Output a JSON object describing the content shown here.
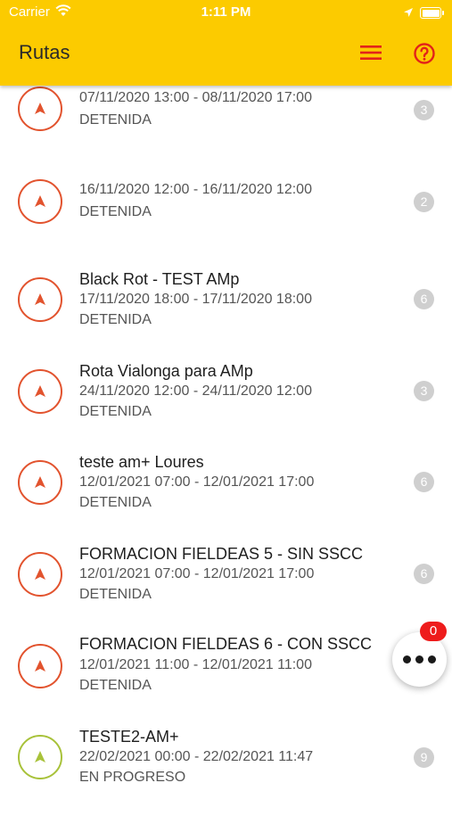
{
  "status_bar": {
    "carrier": "Carrier",
    "time": "1:11 PM"
  },
  "header": {
    "title": "Rutas",
    "menu_icon": "hamburger-menu-icon",
    "help_icon": "question-circle-icon",
    "background_color": "#fccb00",
    "icon_color": "#e2231a"
  },
  "routes": [
    {
      "title": "",
      "dates": "07/11/2020 13:00 - 08/11/2020 17:00",
      "status": "DETENIDA",
      "count": "3",
      "icon": "navigation-arrow-icon",
      "color": "#e2532e"
    },
    {
      "title": "",
      "dates": "16/11/2020 12:00 - 16/11/2020 12:00",
      "status": "DETENIDA",
      "count": "2",
      "icon": "navigation-arrow-icon",
      "color": "#e2532e"
    },
    {
      "title": "Black Rot - TEST AMp",
      "dates": "17/11/2020 18:00 - 17/11/2020 18:00",
      "status": "DETENIDA",
      "count": "6",
      "icon": "navigation-arrow-icon",
      "color": "#e2532e"
    },
    {
      "title": "Rota Vialonga para AMp",
      "dates": "24/11/2020 12:00 - 24/11/2020 12:00",
      "status": "DETENIDA",
      "count": "3",
      "icon": "navigation-arrow-icon",
      "color": "#e2532e"
    },
    {
      "title": "teste am+ Loures",
      "dates": "12/01/2021 07:00 - 12/01/2021 17:00",
      "status": "DETENIDA",
      "count": "6",
      "icon": "navigation-arrow-icon",
      "color": "#e2532e"
    },
    {
      "title": "FORMACION FIELDEAS 5 - SIN SSCC",
      "dates": "12/01/2021 07:00 - 12/01/2021 17:00",
      "status": "DETENIDA",
      "count": "6",
      "icon": "navigation-arrow-icon",
      "color": "#e2532e"
    },
    {
      "title": "FORMACION FIELDEAS 6 - CON SSCC",
      "dates": "12/01/2021 11:00 - 12/01/2021 11:00",
      "status": "DETENIDA",
      "count": "",
      "icon": "navigation-arrow-icon",
      "color": "#e2532e"
    },
    {
      "title": "TESTE2-AM+",
      "dates": "22/02/2021 00:00 - 22/02/2021 11:47",
      "status": "EN PROGRESO",
      "count": "9",
      "icon": "navigation-arrow-icon",
      "color": "#a8c23a"
    }
  ],
  "fab": {
    "icon": "more-dots-icon",
    "badge": "0",
    "badge_color": "#ee1c1c"
  }
}
